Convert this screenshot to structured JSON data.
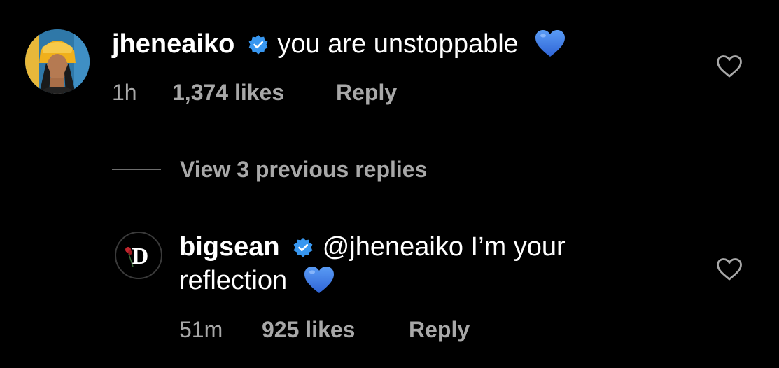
{
  "comments": [
    {
      "avatar_icon": "profile-photo-avatar",
      "username": "jheneaiko",
      "verified_icon": "verified-badge-icon",
      "text_lines": [
        "you are unstoppable"
      ],
      "emoji": "blue-heart-emoji",
      "time": "1h",
      "likes": "1,374 likes",
      "reply_label": "Reply",
      "like_icon": "heart-outline-icon"
    },
    {
      "avatar_icon": "rose-d-logo-avatar",
      "username": "bigsean",
      "verified_icon": "verified-badge-icon",
      "text_lines": [
        "@jheneaiko I’m your",
        "reflection"
      ],
      "emoji": "blue-heart-emoji",
      "time": "51m",
      "likes": "925 likes",
      "reply_label": "Reply",
      "like_icon": "heart-outline-icon"
    }
  ],
  "view_replies": {
    "label": "View 3 previous replies"
  },
  "colors": {
    "background": "#000000",
    "primary_text": "#ffffff",
    "secondary_text": "#a8a8a8",
    "verified_badge": "#3897f0",
    "blue_heart": "#3b7de9"
  }
}
